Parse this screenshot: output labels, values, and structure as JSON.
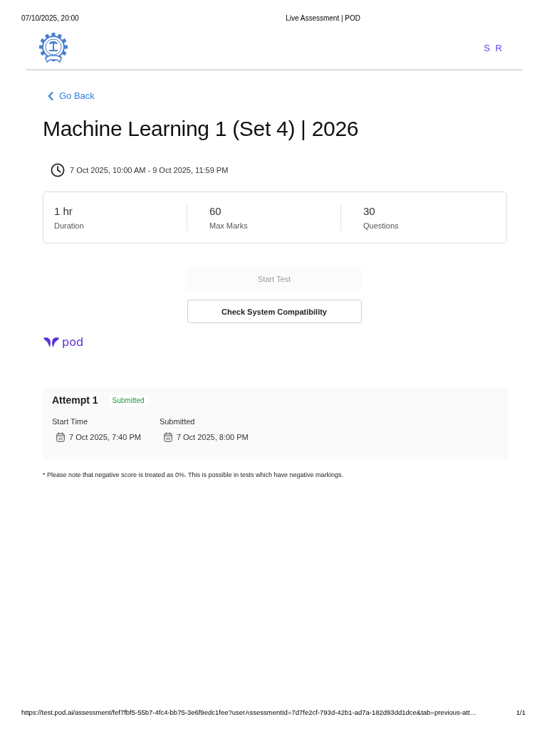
{
  "print_header": {
    "date": "07/10/2025, 20:00",
    "title": "Live Assessment | POD"
  },
  "header": {
    "user_initials": "S R"
  },
  "back_link": {
    "label": "Go Back"
  },
  "test": {
    "title": "Machine Learning 1 (Set 4) | 2026",
    "schedule": "7 Oct 2025, 10:00 AM - 9 Oct 2025, 11:59 PM"
  },
  "stats": [
    {
      "value": "1 hr",
      "label": "Duration"
    },
    {
      "value": "60",
      "label": "Max Marks"
    },
    {
      "value": "30",
      "label": "Questions"
    }
  ],
  "actions": [
    {
      "label": "Start Test",
      "disabled": true
    },
    {
      "label": "Check System Compatibility",
      "disabled": false
    }
  ],
  "brand": {
    "wordmark": "pod"
  },
  "attempts": [
    {
      "title": "Attempt 1",
      "status": "Submitted",
      "fields": [
        {
          "label": "Start Time",
          "value": "7 Oct 2025, 7:40 PM"
        },
        {
          "label": "Submitted",
          "value": "7 Oct 2025, 8:00 PM"
        }
      ]
    }
  ],
  "note": "* Please note that negative score is treated as 0%. This is possible in tests which have negative markings.",
  "print_footer": {
    "url": "https://test.pod.ai/assessment/fef7fbf5-55b7-4fc4-bb75-3e6f9edc1fee?userAssessmentId=7d7fe2cf-793d-42b1-ad7a-182d93dd1dce&tab=previous-att…",
    "page": "1/1"
  }
}
